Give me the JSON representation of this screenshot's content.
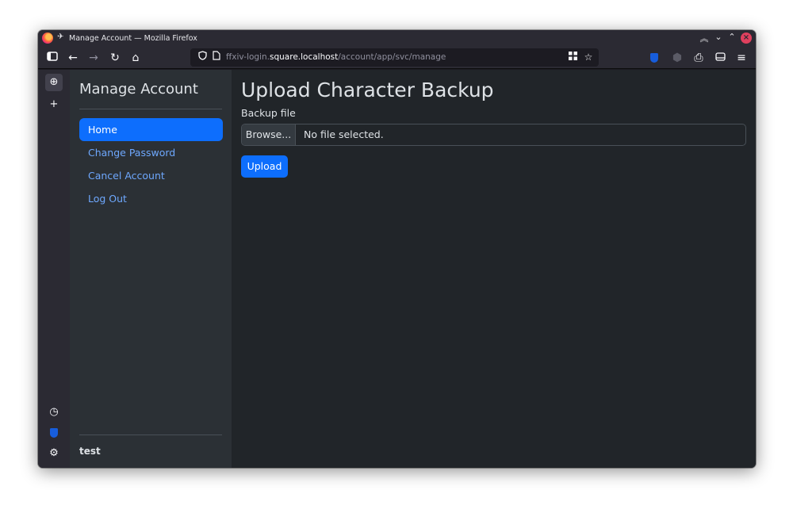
{
  "browser": {
    "window_title": "Manage Account — Mozilla Firefox",
    "url_prefix": "ffxiv-login.",
    "url_host": "square.localhost",
    "url_path": "/account/app/svc/manage"
  },
  "sidebar": {
    "brand": "Manage Account",
    "items": [
      {
        "label": "Home",
        "active": true
      },
      {
        "label": "Change Password",
        "active": false
      },
      {
        "label": "Cancel Account",
        "active": false
      },
      {
        "label": "Log Out",
        "active": false
      }
    ],
    "user": "test"
  },
  "main": {
    "title": "Upload Character Backup",
    "field_label": "Backup file",
    "browse_label": "Browse...",
    "file_status": "No file selected.",
    "upload_label": "Upload"
  },
  "colors": {
    "accent": "#0d6efd",
    "link": "#6ea8fe",
    "background": "#212529",
    "sidebar_background": "#2b3035"
  }
}
